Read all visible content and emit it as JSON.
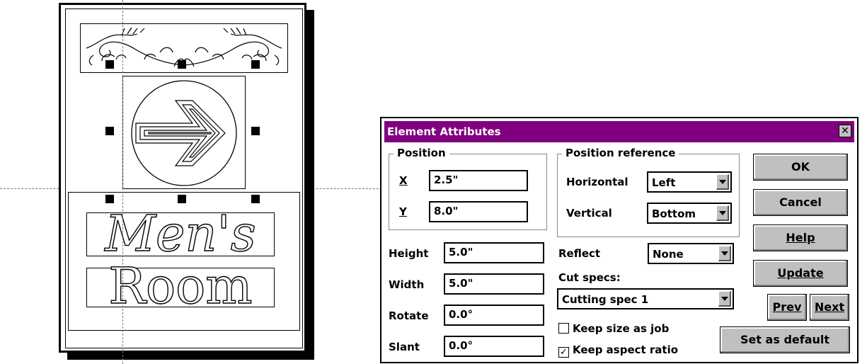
{
  "sign": {
    "line1": "Men's",
    "line2": "Room"
  },
  "dialog": {
    "title": "Element Attributes",
    "close_glyph": "✕",
    "position_group": {
      "label": "Position",
      "x_label": "X",
      "x_value": "2.5\"",
      "y_label": "Y",
      "y_value": "8.0\""
    },
    "reference_group": {
      "label": "Position reference",
      "horizontal_label": "Horizontal",
      "horizontal_value": "Left",
      "vertical_label": "Vertical",
      "vertical_value": "Bottom"
    },
    "fields": {
      "height_label": "Height",
      "height_value": "5.0\"",
      "width_label": "Width",
      "width_value": "5.0\"",
      "rotate_label": "Rotate",
      "rotate_value": "0.0°",
      "slant_label": "Slant",
      "slant_value": "0.0°"
    },
    "reflect": {
      "label": "Reflect",
      "value": "None"
    },
    "cut_specs": {
      "label": "Cut specs:",
      "value": "Cutting spec 1"
    },
    "checkboxes": {
      "keep_size_label": "Keep size as job",
      "keep_size_checked": false,
      "keep_aspect_label": "Keep aspect ratio",
      "keep_aspect_checked": true
    },
    "buttons": {
      "ok": "OK",
      "cancel": "Cancel",
      "help": "Help",
      "update": "Update",
      "prev": "Prev",
      "next": "Next",
      "set_default": "Set as default"
    },
    "colors": {
      "titlebar": "#800080",
      "button_face": "#c0c0c0"
    }
  }
}
